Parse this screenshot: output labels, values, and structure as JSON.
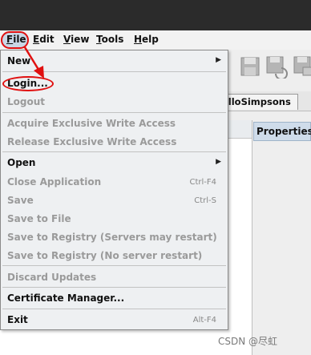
{
  "menubar": {
    "file": "File",
    "file_hotkey": "F",
    "file_rest": "ile",
    "edit_hotkey": "E",
    "edit_rest": "dit",
    "view_hotkey": "V",
    "view_rest": "iew",
    "tools_hotkey": "T",
    "tools_rest": "ools",
    "help_hotkey": "H",
    "help_rest": "elp"
  },
  "tab": {
    "label": "elloSimpsons"
  },
  "properties": {
    "header": "Properties"
  },
  "file_menu": {
    "new": "New",
    "login": "Login...",
    "logout": "Logout",
    "acquire_lock": "Acquire Exclusive Write Access",
    "release_lock": "Release Exclusive Write Access",
    "open": "Open",
    "close_app": "Close Application",
    "close_app_shortcut": "Ctrl-F4",
    "save": "Save",
    "save_shortcut": "Ctrl-S",
    "save_to_file": "Save to File",
    "save_registry_restart": "Save to Registry (Servers may restart)",
    "save_registry_norestart": "Save to Registry (No server restart)",
    "discard": "Discard Updates",
    "cert_manager": "Certificate Manager...",
    "exit": "Exit",
    "exit_shortcut": "Alt-F4"
  },
  "annotation": {
    "color": "#e01010"
  },
  "watermark": "CSDN @尽虹"
}
